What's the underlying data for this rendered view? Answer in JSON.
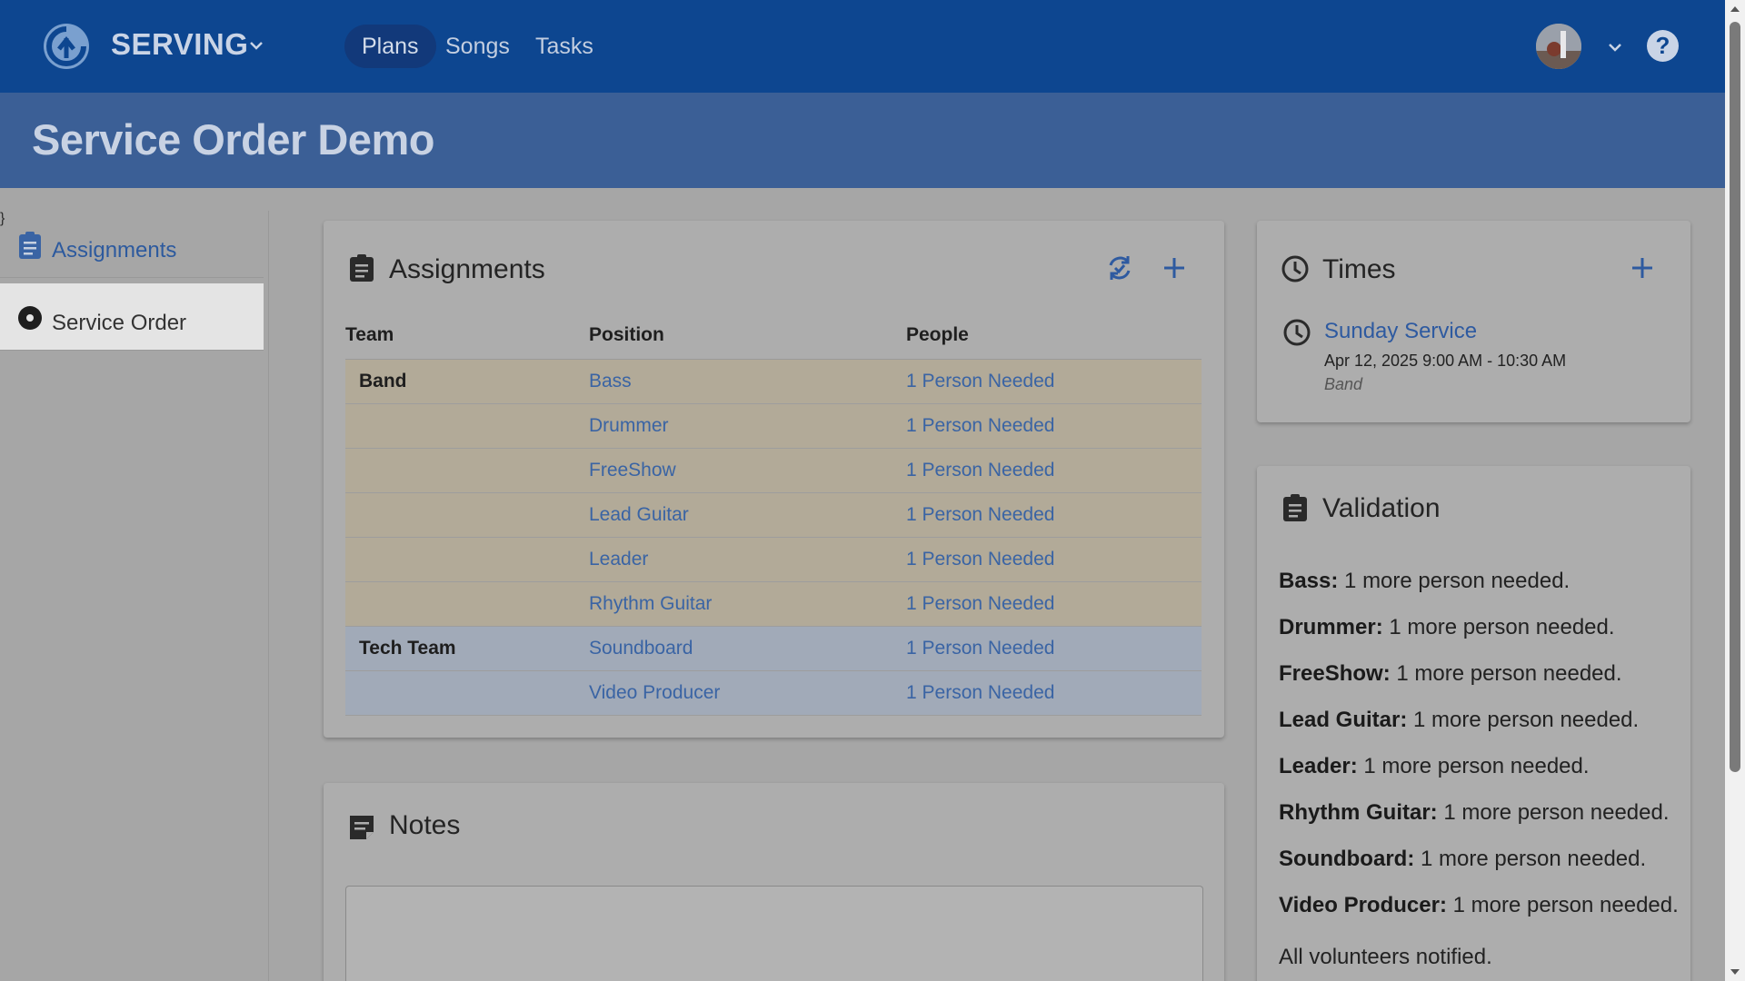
{
  "app": {
    "brand": "SERVING"
  },
  "nav": {
    "items": [
      "Plans",
      "Songs",
      "Tasks"
    ],
    "active": "Plans"
  },
  "page": {
    "title": "Service Order Demo"
  },
  "sidebar": {
    "items": [
      {
        "label": "Assignments",
        "icon": "clipboard-icon"
      },
      {
        "label": "Service Order",
        "icon": "disc-icon"
      }
    ]
  },
  "assignments": {
    "title": "Assignments",
    "columns": [
      "Team",
      "Position",
      "People"
    ],
    "rows": [
      {
        "team": "Band",
        "position": "Bass",
        "people": "1 Person Needed"
      },
      {
        "team": "",
        "position": "Drummer",
        "people": "1 Person Needed"
      },
      {
        "team": "",
        "position": "FreeShow",
        "people": "1 Person Needed"
      },
      {
        "team": "",
        "position": "Lead Guitar",
        "people": "1 Person Needed"
      },
      {
        "team": "",
        "position": "Leader",
        "people": "1 Person Needed"
      },
      {
        "team": "",
        "position": "Rhythm Guitar",
        "people": "1 Person Needed"
      },
      {
        "team": "Tech Team",
        "position": "Soundboard",
        "people": "1 Person Needed"
      },
      {
        "team": "",
        "position": "Video Producer",
        "people": "1 Person Needed"
      }
    ]
  },
  "notes": {
    "title": "Notes"
  },
  "times": {
    "title": "Times",
    "entry": {
      "name": "Sunday Service",
      "date": "Apr 12, 2025 9:00 AM - 10:30 AM",
      "team": "Band"
    }
  },
  "validation": {
    "title": "Validation",
    "items": [
      {
        "role": "Bass:",
        "msg": "1 more person needed."
      },
      {
        "role": "Drummer:",
        "msg": "1 more person needed."
      },
      {
        "role": "FreeShow:",
        "msg": "1 more person needed."
      },
      {
        "role": "Lead Guitar:",
        "msg": "1 more person needed."
      },
      {
        "role": "Leader:",
        "msg": "1 more person needed."
      },
      {
        "role": "Rhythm Guitar:",
        "msg": "1 more person needed."
      },
      {
        "role": "Soundboard:",
        "msg": "1 more person needed."
      },
      {
        "role": "Video Producer:",
        "msg": "1 more person needed."
      }
    ],
    "footer": "All volunteers notified."
  },
  "colors": {
    "nav": "#0d4690",
    "banner": "#3b5f96",
    "link": "#3a64a4",
    "band_row": "#b2aa98",
    "tech_row": "#a1aab8"
  }
}
